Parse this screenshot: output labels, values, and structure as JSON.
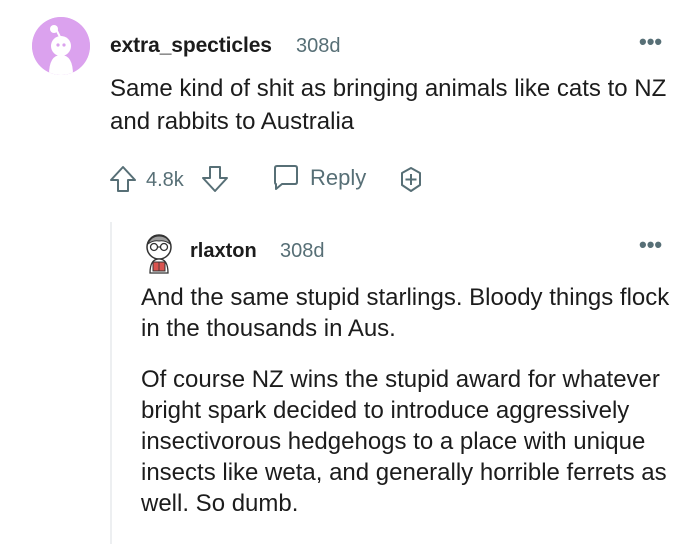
{
  "comment": {
    "username": "extra_specticles",
    "age": "308d",
    "more": "•••",
    "body": "Same kind of shit as bringing animals like cats to NZ and rabbits to Australia",
    "score": "4.8k",
    "reply_label": "Reply",
    "avatar_color": "#dba2ee"
  },
  "reply": {
    "username": "rlaxton",
    "age": "308d",
    "more": "•••",
    "paragraphs": [
      "And the same stupid starlings. Bloody things flock in the thousands in Aus.",
      "Of course NZ wins the stupid award for whatever bright spark decided to introduce aggressively insectivorous hedgehogs to a place with unique insects like weta, and generally horrible ferrets as well. So dumb."
    ]
  },
  "icons": {
    "upvote": "upvote-arrow-icon",
    "downvote": "downvote-arrow-icon",
    "reply": "speech-bubble-icon",
    "award": "award-plus-icon",
    "more": "more-options-icon"
  },
  "colors": {
    "text": "#1c1c1c",
    "meta": "#576f76",
    "thread_line": "#edeff1"
  }
}
